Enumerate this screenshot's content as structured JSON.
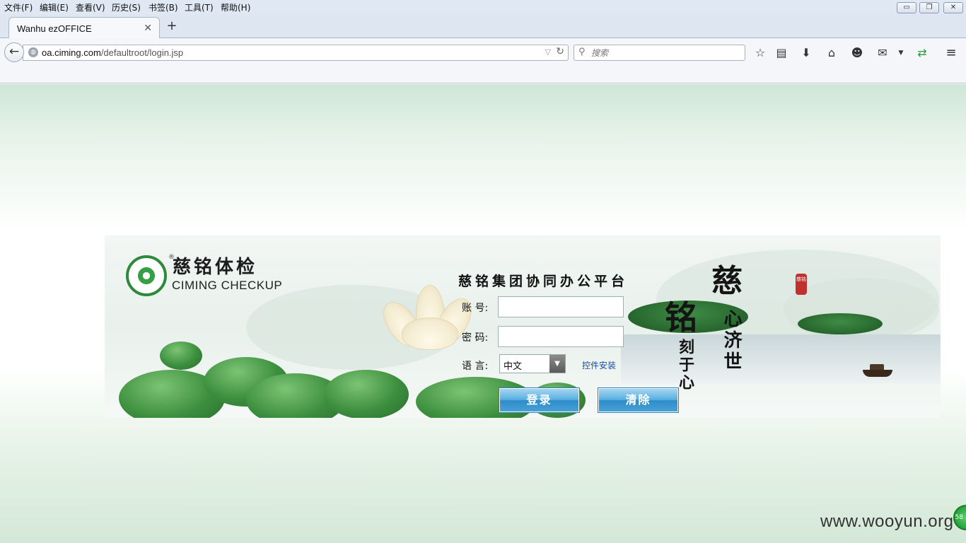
{
  "browser": {
    "menu": [
      "文件(F)",
      "编辑(E)",
      "查看(V)",
      "历史(S)",
      "书签(B)",
      "工具(T)",
      "帮助(H)"
    ],
    "tab_title": "Wanhu ezOFFICE",
    "url_host": "oa.ciming.com",
    "url_path": "/defaultroot/login.jsp",
    "search_placeholder": "搜索"
  },
  "logo": {
    "name_cn": "慈铭体检",
    "name_en": "CIMING CHECKUP",
    "reg_mark": "®"
  },
  "login": {
    "title": "慈铭集团协同办公平台",
    "account_label": "账 号:",
    "password_label": "密 码:",
    "language_label": "语 言:",
    "language_value": "中文",
    "install_link": "控件安装",
    "login_button": "登录",
    "clear_button": "清除"
  },
  "calligraphy": {
    "col1_top": "慈",
    "col1_rest": "心济世",
    "col2_top": "铭",
    "col2_rest": "刻于心",
    "seal": "慈铭"
  },
  "watermark": "www.wooyun.org",
  "badge_text": "58",
  "colors": {
    "button_blue": "#3c98d4",
    "logo_green": "#2d8a3a",
    "link_blue": "#1a4c9e"
  }
}
